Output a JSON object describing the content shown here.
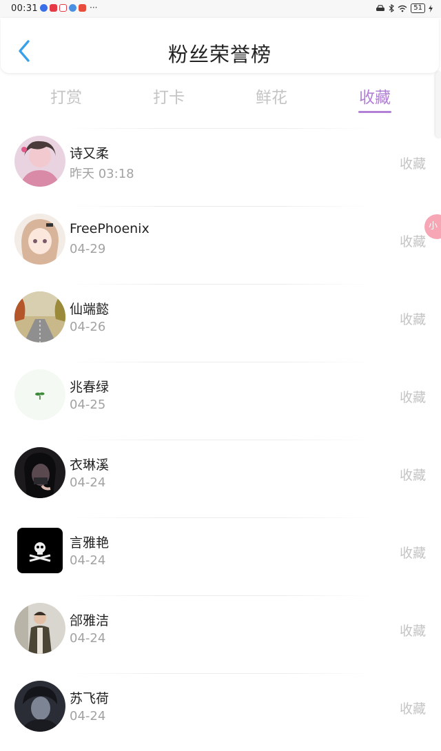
{
  "status_bar": {
    "time": "00:31",
    "app_icon_colors": [
      "#3a6ee8",
      "#e63946",
      "#e63946",
      "#4a90e2",
      "#e74c3c"
    ],
    "more": "···",
    "battery": "51"
  },
  "header": {
    "title": "粉丝荣誉榜",
    "back_icon": "chevron-left-icon",
    "accent_color": "#3aa0e8"
  },
  "tabs": [
    {
      "label": "打赏",
      "active": false
    },
    {
      "label": "打卡",
      "active": false
    },
    {
      "label": "鲜花",
      "active": false
    },
    {
      "label": "收藏",
      "active": true
    }
  ],
  "active_color": "#b27fd6",
  "rows": [
    {
      "name": "诗又柔",
      "date": "昨天 03:18",
      "action": "收藏",
      "avatar": "avatar-girl-pink"
    },
    {
      "name": "FreePhoenix",
      "date": "04-29",
      "action": "收藏",
      "avatar": "avatar-anime-girl"
    },
    {
      "name": "仙端懿",
      "date": "04-26",
      "action": "收藏",
      "avatar": "avatar-autumn-road"
    },
    {
      "name": "兆春绿",
      "date": "04-25",
      "action": "收藏",
      "avatar": "avatar-sprout"
    },
    {
      "name": "衣琳溪",
      "date": "04-24",
      "action": "收藏",
      "avatar": "avatar-dark-portrait"
    },
    {
      "name": "言雅艳",
      "date": "04-24",
      "action": "收藏",
      "avatar": "avatar-skull"
    },
    {
      "name": "郃雅洁",
      "date": "04-24",
      "action": "收藏",
      "avatar": "avatar-man-coat"
    },
    {
      "name": "苏飞荷",
      "date": "04-24",
      "action": "收藏",
      "avatar": "avatar-dark-boy"
    }
  ]
}
